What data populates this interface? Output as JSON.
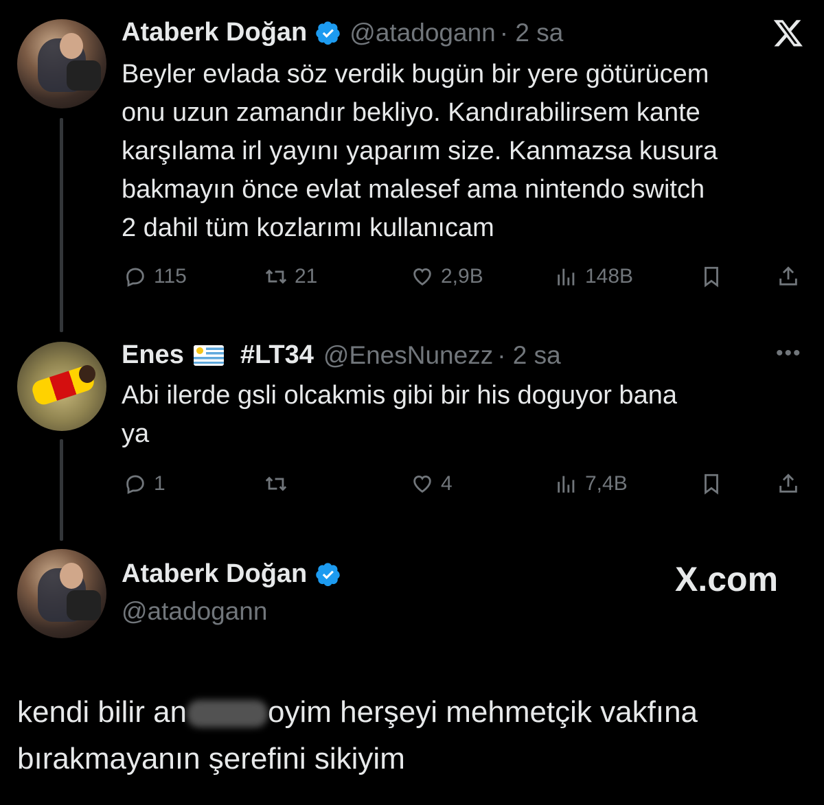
{
  "tweets": [
    {
      "name": "Ataberk Doğan",
      "handle": "@atadogann",
      "time": "· 2 sa",
      "lines": [
        "Beyler evlada söz verdik bugün bir yere götürücem",
        "onu uzun zamandır bekliyo. Kandırabilirsem kante",
        "karşılama irl yayını yaparım size. Kanmazsa kusura",
        "bakmayın önce evlat malesef ama nintendo switch",
        "2 dahil tüm kozlarımı kullanıcam"
      ],
      "stats": {
        "replies": "115",
        "retweets": "21",
        "likes": "2,9B",
        "views": "148B"
      }
    },
    {
      "name": "Enes",
      "flag": "🇺🇾",
      "tag": "#LT34",
      "handle": "@EnesNunezz",
      "time": "· 2 sa",
      "lines": [
        "Abi ilerde gsli olcakmis gibi bir his doguyor bana",
        "ya"
      ],
      "stats": {
        "replies": "1",
        "retweets": "",
        "likes": "4",
        "views": "7,4B"
      }
    }
  ],
  "main": {
    "name": "Ataberk Doğan",
    "handle": "@atadogann",
    "brand": "X.com",
    "line1_before": "kendi bilir an",
    "line1_after": "oyim herşeyi mehmetçik vakfına",
    "line2": "bırakmayanın şerefini sikiyim"
  },
  "icons": {
    "close": "x-logo-icon",
    "verified": "verified-badge-icon",
    "reply": "reply-icon",
    "retweet": "retweet-icon",
    "like": "heart-icon",
    "views": "views-icon",
    "bookmark": "bookmark-icon",
    "share": "share-icon",
    "more": "more-icon"
  },
  "colors": {
    "background": "#000000",
    "text": "#e7e9ea",
    "muted": "#71767b",
    "verified": "#1d9bf0"
  }
}
